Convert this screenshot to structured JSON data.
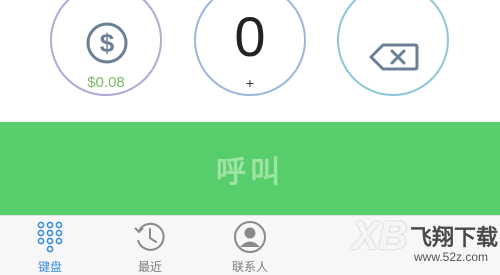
{
  "dialer": {
    "balance": "$0.08",
    "zero_key": {
      "digit": "0",
      "sub": "+"
    }
  },
  "call_button": {
    "label": "呼叫",
    "color": "#57cd6b"
  },
  "tabs": [
    {
      "label": "键盘",
      "icon": "keypad-icon",
      "active": true
    },
    {
      "label": "最近",
      "icon": "recents-icon",
      "active": false
    },
    {
      "label": "联系人",
      "icon": "contacts-icon",
      "active": false
    }
  ],
  "watermark": {
    "logo": "XB",
    "brand": "飞翔下载",
    "url": "www.52z.com"
  },
  "colors": {
    "accent": "#3a8fd9",
    "balance": "#79bb6a"
  }
}
